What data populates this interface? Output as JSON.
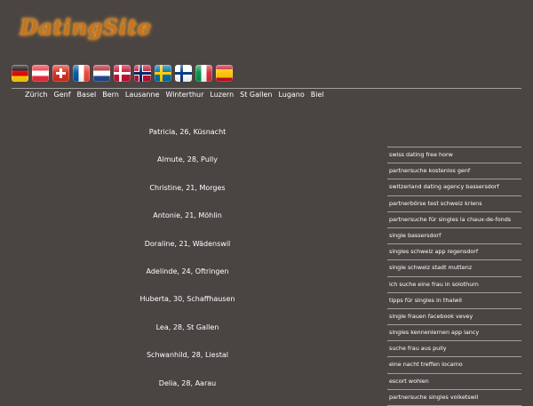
{
  "logo": {
    "text": "DatingSite"
  },
  "flags": [
    "de",
    "at",
    "ch",
    "fr",
    "nl",
    "dk",
    "no",
    "se",
    "fi",
    "it",
    "es"
  ],
  "cities": [
    "Zürich",
    "Genf",
    "Basel",
    "Bern",
    "Lausanne",
    "Winterthur",
    "Luzern",
    "St Gallen",
    "Lugano",
    "Biel"
  ],
  "profiles": [
    "Patricia, 26, Küsnacht",
    "Almute, 28, Pully",
    "Christine, 21, Morges",
    "Antonie, 21, Möhlin",
    "Doraline, 21, Wädenswil",
    "Adelinde, 24, Oftringen",
    "Huberta, 30, Schaffhausen",
    "Lea, 28, St Gallen",
    "Schwanhild, 28, Liestal",
    "Delia, 28, Aarau"
  ],
  "side_links": [
    "swiss dating free horw",
    "partnersuche kostenlos genf",
    "switzerland dating agency bassersdorf",
    "partnerbörse test schweiz kriens",
    "partnersuche für singles la chaux-de-fonds",
    "single bassersdorf",
    "singles schweiz app regensdorf",
    "single schweiz stadt muttenz",
    "ich suche eine frau in solothurn",
    "tipps für singles in thalwil",
    "single frauen facebook vevey",
    "singles kennenlernen app lancy",
    "suche frau aus pully",
    "eine nacht treffen locarno",
    "escort wohlen",
    "partnersuche singles volketswil"
  ]
}
